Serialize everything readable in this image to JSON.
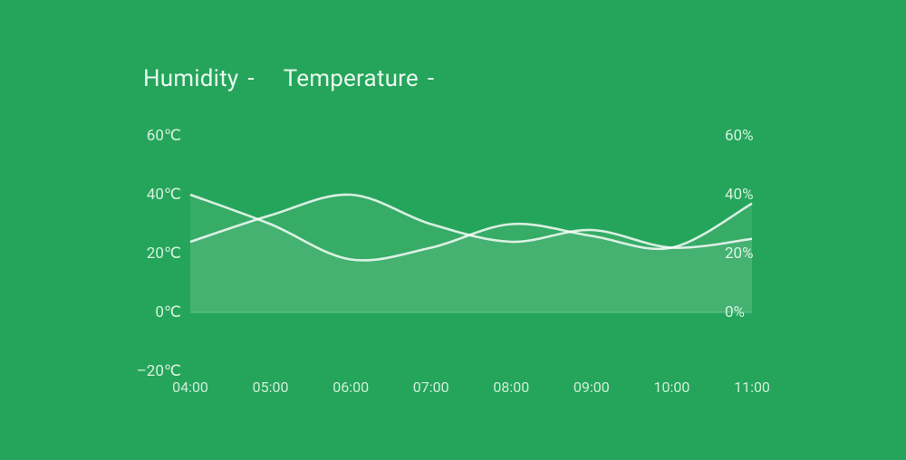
{
  "legend": {
    "humidity_label": "Humidity",
    "humidity_value": "-",
    "temperature_label": "Temperature",
    "temperature_value": "-"
  },
  "chart_data": {
    "type": "line",
    "x": [
      "04:00",
      "05:00",
      "06:00",
      "07:00",
      "08:00",
      "09:00",
      "10:00",
      "11:00"
    ],
    "series": [
      {
        "name": "Temperature",
        "axis": "left",
        "unit": "℃",
        "values": [
          24,
          33,
          40,
          30,
          24,
          28,
          22,
          25
        ]
      },
      {
        "name": "Humidity",
        "axis": "right",
        "unit": "%",
        "values": [
          40,
          30,
          18,
          22,
          30,
          26,
          22,
          37
        ]
      }
    ],
    "left_axis": {
      "label": "",
      "unit": "℃",
      "ticks": [
        60,
        40,
        20,
        0,
        -20
      ],
      "range": [
        -20,
        60
      ]
    },
    "right_axis": {
      "label": "",
      "unit": "%",
      "ticks": [
        60,
        40,
        20,
        0
      ],
      "range": [
        -20,
        60
      ]
    },
    "title": ""
  },
  "colors": {
    "bg": "#25a55b",
    "text": "#eaf7ee"
  }
}
